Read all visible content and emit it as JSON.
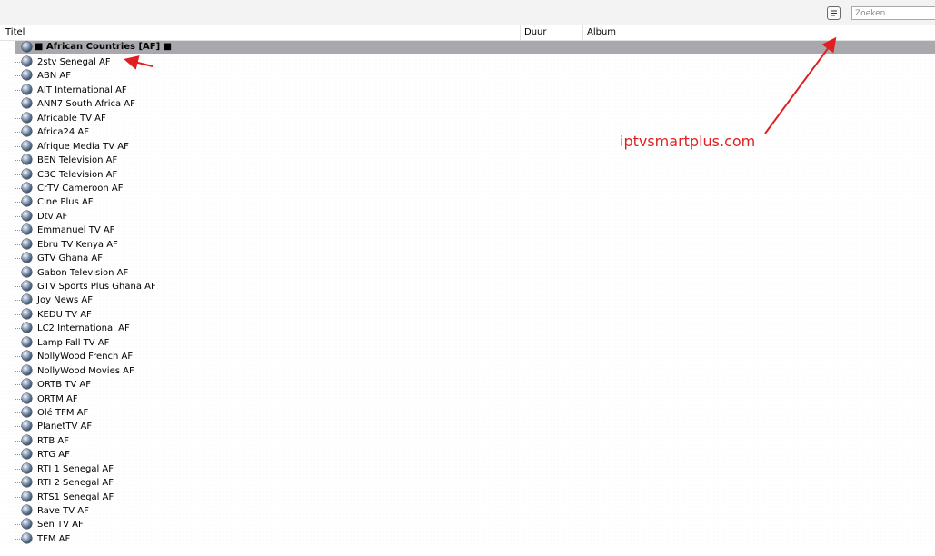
{
  "toolbar": {
    "view_icon": "list-view-icon",
    "search_placeholder": "Zoeken",
    "search_value": ""
  },
  "columns": {
    "title": "Titel",
    "duration": "Duur",
    "album": "Album"
  },
  "group": {
    "label": "■ African Countries [AF] ■",
    "icon": "globe-icon"
  },
  "channels": [
    "2stv Senegal AF",
    "ABN AF",
    "AIT International AF",
    "ANN7 South Africa AF",
    "Africable TV AF",
    "Africa24 AF",
    "Afrique Media TV AF",
    "BEN Television AF",
    "CBC Television AF",
    "CrTV Cameroon AF",
    "Cine Plus AF",
    "Dtv AF",
    "Emmanuel TV AF",
    "Ebru TV Kenya AF",
    "GTV Ghana AF",
    "Gabon Television AF",
    "GTV Sports Plus Ghana AF",
    "Joy News AF",
    "KEDU TV AF",
    "LC2 International AF",
    "Lamp Fall TV AF",
    "NollyWood French AF",
    "NollyWood Movies AF",
    "ORTB TV AF",
    "ORTM AF",
    "Olé TFM AF",
    "PlanetTV AF",
    "RTB AF",
    "RTG AF",
    "RTI 1 Senegal AF",
    "RTI 2 Senegal AF",
    "RTS1 Senegal AF",
    "Rave TV AF",
    "Sen TV AF",
    "TFM AF"
  ],
  "annotation": {
    "text": "iptvsmartplus.com",
    "color": "#e02020"
  },
  "colors": {
    "group_row_bg": "#a9a9ad",
    "highlight": "#e02020"
  }
}
